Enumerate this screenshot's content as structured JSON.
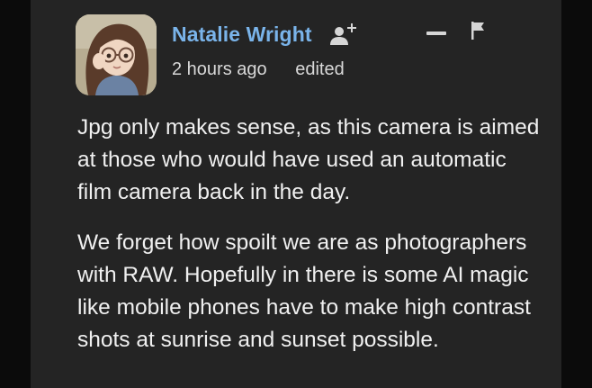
{
  "comment": {
    "author": "Natalie Wright",
    "timestamp": "2 hours ago",
    "edited_label": "edited",
    "paragraphs": [
      "Jpg only makes sense, as this camera is aimed at those who would have used an automatic film camera back in the day.",
      "We forget how spoilt we are as photographers with RAW. Hopefully in there is some AI magic like mobile phones have to make high contrast shots at sunrise and sunset possible."
    ]
  },
  "icons": {
    "follow": "add-user-icon",
    "collapse": "minus-icon",
    "report": "flag-icon",
    "avatar": "user-avatar"
  },
  "colors": {
    "background": "#242424",
    "page_edge": "#0b0b0b",
    "author_name": "#7ab4ea",
    "text": "#f0f0f0",
    "icon": "#d6d6d6"
  }
}
